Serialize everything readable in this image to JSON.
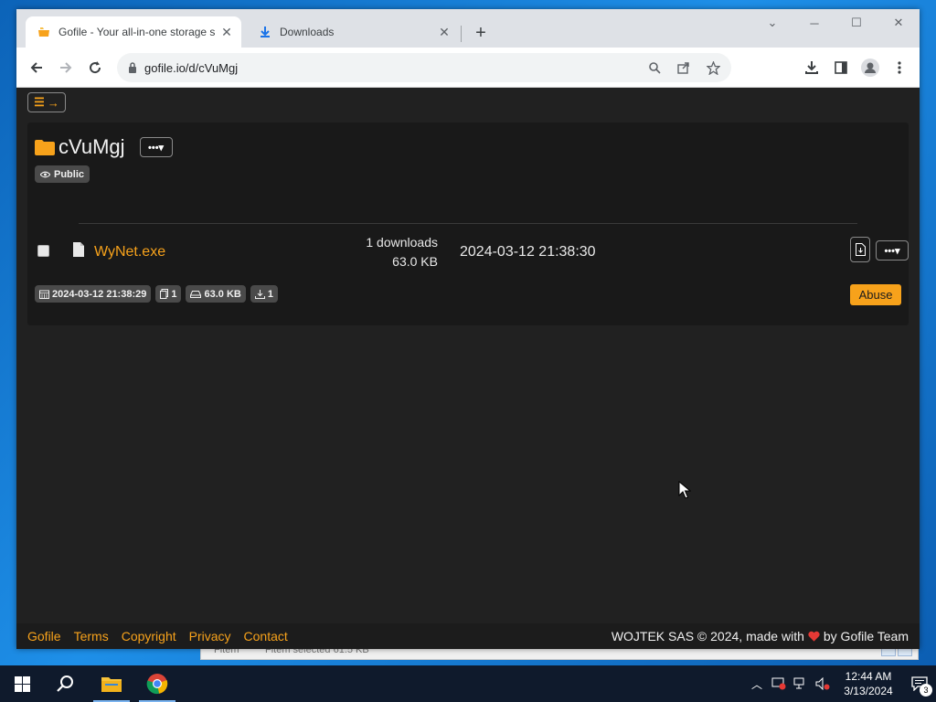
{
  "browser": {
    "tabs": [
      {
        "title": "Gofile - Your all-in-one storage s",
        "favicon": "gofile-favicon-icon",
        "active": true
      },
      {
        "title": "Downloads",
        "favicon": "download-icon",
        "active": false
      }
    ],
    "address": "gofile.io/d/cVuMgj"
  },
  "page": {
    "folder_name": "cVuMgj",
    "visibility": "Public",
    "file": {
      "name": "WyNet.exe",
      "downloads": "1 downloads",
      "size": "63.0 KB",
      "date": "2024-03-12 21:38:30"
    },
    "meta": {
      "created": "2024-03-12 21:38:29",
      "file_count": "1",
      "total_size": "63.0 KB",
      "download_count": "1"
    },
    "abuse_label": "Abuse",
    "accent_color": "#f7a21b",
    "background_color": "#212121"
  },
  "footer": {
    "links": [
      "Gofile",
      "Terms",
      "Copyright",
      "Privacy",
      "Contact"
    ],
    "copyright_prefix": "WOJTEK SAS © 2024, made with",
    "copyright_suffix": "by Gofile Team"
  },
  "background_window": {
    "status_left": "Fitem",
    "status_right": "Fitem selected  61.5 KB"
  },
  "taskbar": {
    "time": "12:44 AM",
    "date": "3/13/2024",
    "notification_count": "3"
  }
}
